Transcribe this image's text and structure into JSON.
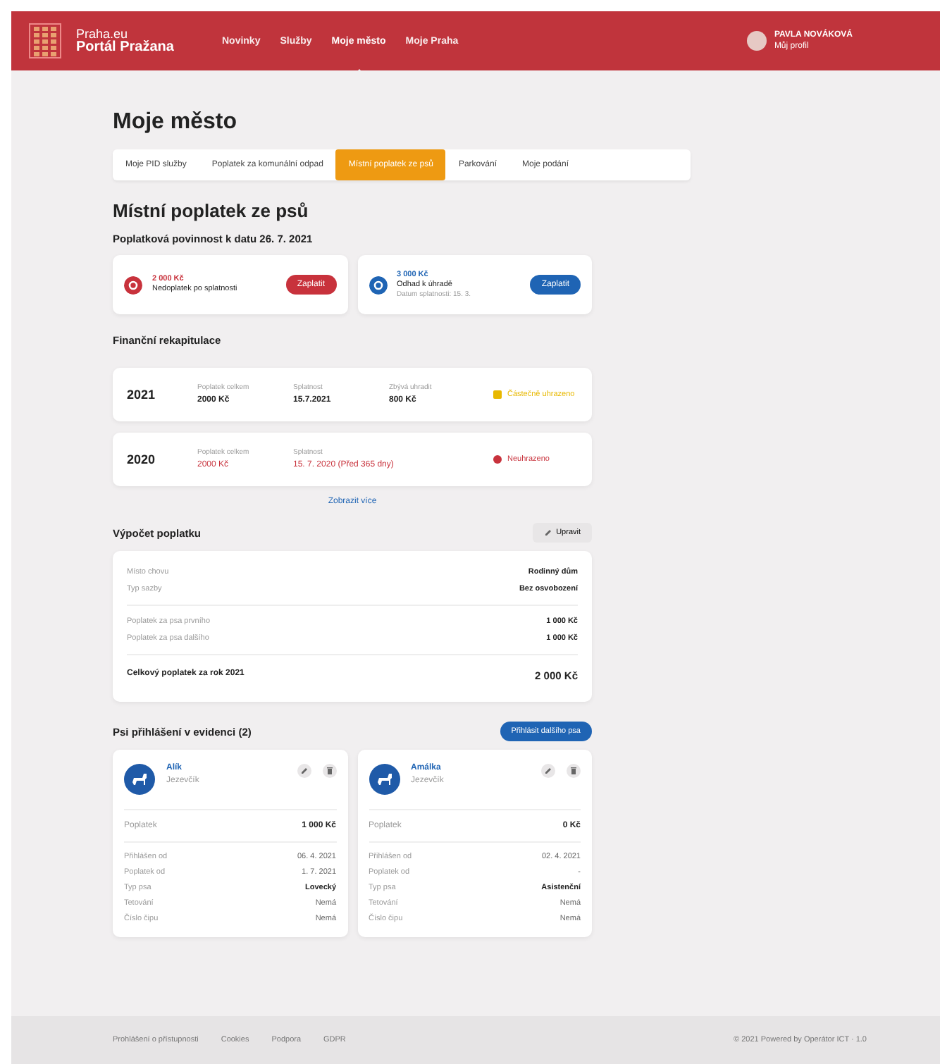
{
  "header": {
    "logo_line1": "Praha.eu",
    "logo_line2": "Portál Pražana",
    "nav": [
      {
        "label": "Novinky",
        "selected": false
      },
      {
        "label": "Služby",
        "selected": false
      },
      {
        "label": "Moje město",
        "selected": true
      },
      {
        "label": "Moje Praha",
        "selected": false
      }
    ],
    "user": {
      "name": "PAVLA NOVÁKOVÁ",
      "subtitle": "Můj profil"
    }
  },
  "page_title": "Moje město",
  "tabs": [
    {
      "label": "Moje PID služby",
      "selected": false
    },
    {
      "label": "Poplatek za komunální odpad",
      "selected": false
    },
    {
      "label": "Místní poplatek ze psů",
      "selected": true
    },
    {
      "label": "Parkování",
      "selected": false
    },
    {
      "label": "Moje podání",
      "selected": false
    }
  ],
  "section_title": "Místní poplatek ze psů",
  "obligation": {
    "title": "Poplatková povinnost k datu 26. 7. 2021",
    "cards": [
      {
        "amount": "2 000 Kč",
        "label": "Nedoplatek po splatnosti",
        "button": "Zaplatit",
        "color": "#c8323c"
      },
      {
        "amount": "3 000 Kč",
        "label": "Odhad k úhradě",
        "note": "Datum splatnosti: 15. 3.",
        "button": "Zaplatit",
        "color": "#1f64b4"
      }
    ]
  },
  "finance": {
    "title": "Finanční rekapitulace",
    "rows": [
      {
        "year": "2021",
        "fields": [
          {
            "label": "Poplatek celkem",
            "value": "2000 Kč"
          },
          {
            "label": "Splatnost",
            "value": "15.7.2021"
          },
          {
            "label": "Zbývá uhradit",
            "value": "800 Kč"
          }
        ],
        "status": "Částečně uhrazeno",
        "color": "#e8b800",
        "overdue": false
      },
      {
        "year": "2020",
        "fields": [
          {
            "label": "Poplatek celkem",
            "value": "2000 Kč"
          },
          {
            "label": "Splatnost",
            "value": "15. 7. 2020",
            "note": "(Před 365 dny)"
          }
        ],
        "status": "Neuhrazeno",
        "color": "#c8323c",
        "overdue": true
      }
    ],
    "more_link": "Zobrazit více"
  },
  "calculation": {
    "title": "Výpočet poplatku",
    "edit_button": "Upravit",
    "groups": [
      [
        {
          "label": "Místo chovu",
          "value": "Rodinný dům"
        },
        {
          "label": "Typ sazby",
          "value": "Bez osvobození"
        }
      ],
      [
        {
          "label": "Poplatek za psa prvního",
          "value": "1 000 Kč"
        },
        {
          "label": "Poplatek za psa dalšího",
          "value": "1 000 Kč"
        }
      ]
    ],
    "total": {
      "label": "Celkový poplatek za rok 2021",
      "value": "2 000 Kč"
    }
  },
  "dogs": {
    "title": "Psi přihlášení v evidenci (2)",
    "add_button": "Přihlásit dalšího psa",
    "items": [
      {
        "name": "Alík",
        "breed": "Jezevčík",
        "fee": {
          "label": "Poplatek",
          "value": "1 000 Kč"
        },
        "details": [
          {
            "label": "Přihlášen od",
            "value": "06. 4. 2021"
          },
          {
            "label": "Poplatek od",
            "value": "1. 7. 2021"
          },
          {
            "label": "Typ psa",
            "value": "Lovecký",
            "strong": true
          },
          {
            "label": "Tetování",
            "value": "Nemá"
          },
          {
            "label": "Číslo čipu",
            "value": "Nemá"
          }
        ]
      },
      {
        "name": "Amálka",
        "breed": "Jezevčík",
        "fee": {
          "label": "Poplatek",
          "value": "0 Kč"
        },
        "details": [
          {
            "label": "Přihlášen od",
            "value": "02. 4. 2021"
          },
          {
            "label": "Poplatek od",
            "value": "-"
          },
          {
            "label": "Typ psa",
            "value": "Asistenční",
            "strong": true
          },
          {
            "label": "Tetování",
            "value": "Nemá"
          },
          {
            "label": "Číslo čipu",
            "value": "Nemá"
          }
        ]
      }
    ]
  },
  "footer": {
    "links": [
      "Prohlášení o přístupnosti",
      "Cookies",
      "Podpora",
      "GDPR"
    ],
    "copyright": "© 2021 Powered by Operátor ICT · 1.0"
  }
}
